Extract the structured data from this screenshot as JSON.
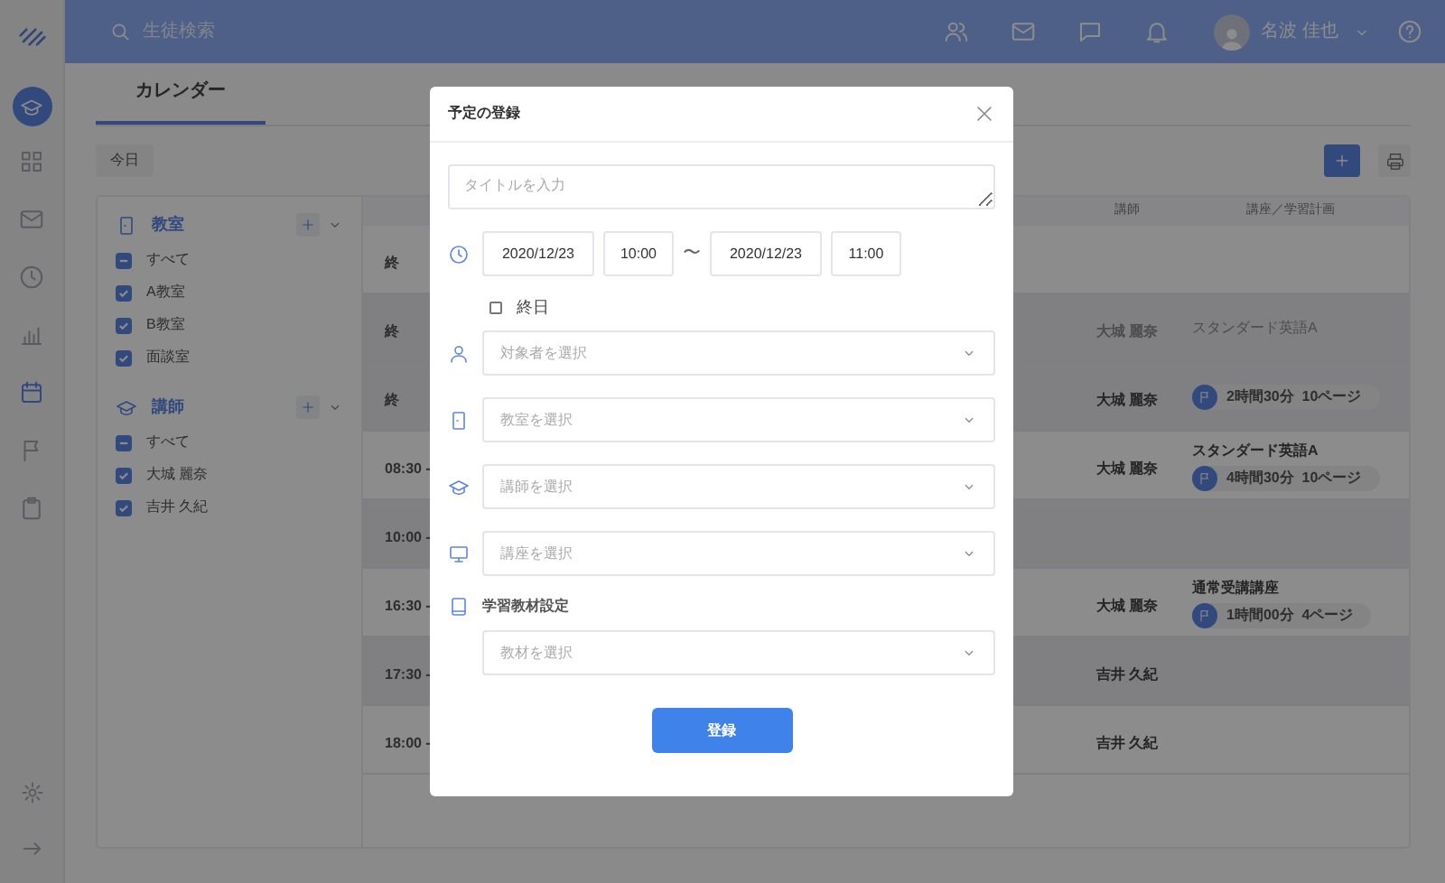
{
  "topbar": {
    "search": {
      "placeholder": "生徒検索"
    },
    "icons": [
      {
        "kind": "users"
      },
      {
        "kind": "mail"
      },
      {
        "kind": "chat"
      },
      {
        "kind": "bell"
      }
    ],
    "user_name": "名波 佳也"
  },
  "sidebar": {
    "items": [
      {
        "kind": "grid",
        "selected": false
      },
      {
        "kind": "mail",
        "selected": false
      },
      {
        "kind": "clock",
        "selected": false
      },
      {
        "kind": "chart",
        "selected": false
      },
      {
        "kind": "calendar",
        "selected": true
      },
      {
        "kind": "flag",
        "selected": false
      },
      {
        "kind": "clipboard",
        "selected": false
      }
    ],
    "bottom": [
      {
        "kind": "gear"
      },
      {
        "kind": "logout"
      }
    ]
  },
  "tabs": [
    {
      "label": "カレンダー",
      "selected": true
    }
  ],
  "today_button": "今日",
  "filters": [
    {
      "title": "教室",
      "kind": "door",
      "items": [
        {
          "label": "すべて",
          "kind": "all",
          "checked": true
        },
        {
          "label": "A教室",
          "kind": "single",
          "checked": true
        },
        {
          "label": "B教室",
          "kind": "single",
          "checked": true
        },
        {
          "label": "面談室",
          "kind": "single",
          "checked": true
        }
      ]
    },
    {
      "title": "講師",
      "kind": "cap",
      "items": [
        {
          "label": "すべて",
          "kind": "all",
          "checked": true
        },
        {
          "label": "大城 麗奈",
          "kind": "single",
          "checked": true
        },
        {
          "label": "吉井 久紀",
          "kind": "single",
          "checked": true
        }
      ]
    }
  ],
  "table": {
    "columns": [
      "講師",
      "講座／学習計画"
    ],
    "rows": [
      {
        "time": "終",
        "shaded": false
      },
      {
        "time": "終",
        "teacher": "大城 麗奈",
        "course": "スタンダード英語A",
        "shaded": true,
        "faded": true
      },
      {
        "time": "終",
        "teacher": "大城 麗奈",
        "plan": "2時間30分  10ページ",
        "shaded": true,
        "faded": false
      },
      {
        "time": "08:30 -",
        "teacher": "大城 麗奈",
        "course": "スタンダード英語A",
        "plan": "4時間30分  10ページ",
        "shaded": false,
        "faded": false
      },
      {
        "time": "10:00 -",
        "shaded": true
      },
      {
        "time": "16:30 -",
        "teacher": "大城 麗奈",
        "course": "通常受講講座",
        "plan": "1時間00分  4ページ",
        "shaded": false,
        "faded": false
      },
      {
        "time": "17:30 -",
        "teacher": "吉井 久紀",
        "shaded": true,
        "faded": false
      },
      {
        "time": "18:00 -",
        "teacher": "吉井 久紀",
        "shaded": false,
        "faded": false
      }
    ]
  },
  "modal": {
    "title": "予定の登録",
    "title_field": {
      "placeholder": "タイトルを入力"
    },
    "start_date": "2020/12/23",
    "start_time": "10:00",
    "separator": "〜",
    "end_date": "2020/12/23",
    "end_time": "11:00",
    "all_day": {
      "label": "終日",
      "checked": false
    },
    "selects": [
      {
        "kind": "person",
        "placeholder": "対象者を選択"
      },
      {
        "kind": "door",
        "placeholder": "教室を選択"
      },
      {
        "kind": "cap",
        "placeholder": "講師を選択"
      },
      {
        "kind": "monitor",
        "placeholder": "講座を選択"
      }
    ],
    "material": {
      "label": "学習教材設定",
      "placeholder": "教材を選択"
    },
    "submit": "登録"
  }
}
